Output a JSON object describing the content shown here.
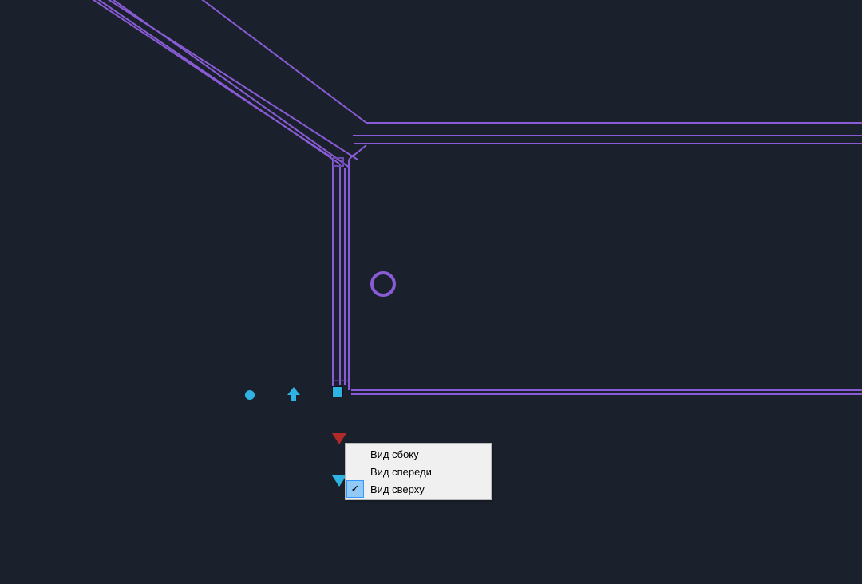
{
  "canvas": {
    "background": "#1b212c",
    "stroke_primary": "#8a5bd6",
    "stroke_secondary": "#6b4bb0",
    "accent": "#2fb3e2",
    "danger": "#b02a2a"
  },
  "markers": {
    "dot_icon": "circle-filled-icon",
    "arrow_up_icon": "arrow-up-icon",
    "arrow_down_red_icon": "arrow-down-icon",
    "arrow_down_blue_icon": "arrow-down-icon",
    "grip_icon": "grip-square-icon"
  },
  "context_menu": {
    "items": [
      {
        "label": "Вид сбоку",
        "checked": false
      },
      {
        "label": "Вид спереди",
        "checked": false
      },
      {
        "label": "Вид сверху",
        "checked": true
      }
    ],
    "check_glyph": "✓"
  }
}
